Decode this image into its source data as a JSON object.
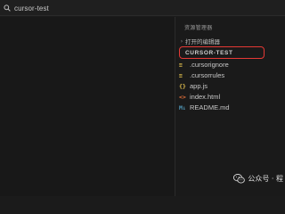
{
  "titlebar": {
    "search_text": "cursor-test",
    "search_icon": "search-icon"
  },
  "explorer": {
    "title": "资源管理器",
    "open_editors_label": "打开的编辑器",
    "folder_name": "CURSOR-TEST",
    "files": [
      {
        "name": ".cursorignore",
        "icon": "≡",
        "icon_color": "#d4b44a"
      },
      {
        "name": ".cursorrules",
        "icon": "≡",
        "icon_color": "#d4b44a"
      },
      {
        "name": "app.js",
        "icon": "{}",
        "icon_color": "#e5c24f"
      },
      {
        "name": "index.html",
        "icon": "<>",
        "icon_color": "#e2703a"
      },
      {
        "name": "README.md",
        "icon": "M↓",
        "icon_color": "#519aba"
      }
    ]
  },
  "watermark": {
    "text": "公众号 · 程"
  },
  "colors": {
    "highlight": "#e53935",
    "background": "#1b1b1b"
  }
}
